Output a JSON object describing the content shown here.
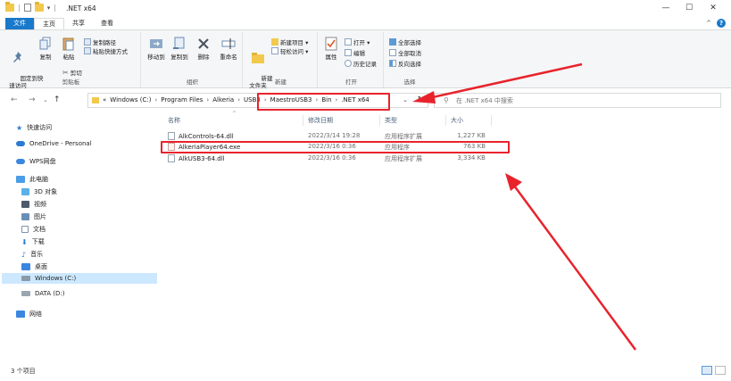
{
  "window": {
    "title": ".NET x64",
    "minimize": "—",
    "maximize": "☐",
    "close": "✕"
  },
  "tabs": [
    "文件",
    "主页",
    "共享",
    "查看"
  ],
  "ribbon": {
    "clipboard": {
      "pin_label": "固定到快\n速访问",
      "copy_label": "复制",
      "paste_label": "粘贴",
      "copy_path": "复制路径",
      "paste_shortcut": "粘贴快捷方式",
      "cut": "剪切",
      "group_label": "剪贴板"
    },
    "organize": {
      "move_to": "移动到",
      "copy_to": "复制到",
      "delete": "删除",
      "rename": "重命名",
      "group_label": "组织"
    },
    "new": {
      "new_folder": "新建\n文件夹",
      "new_item": "新建项目 ▾",
      "easy_access": "轻松访问 ▾",
      "group_label": "新建"
    },
    "open": {
      "properties": "属性",
      "open": "打开 ▾",
      "edit": "编辑",
      "history": "历史记录",
      "group_label": "打开"
    },
    "select": {
      "select_all": "全部选择",
      "select_none": "全部取消",
      "invert": "反向选择",
      "group_label": "选择"
    }
  },
  "address": {
    "crumbs": [
      "«",
      "Windows (C:)",
      "Program Files",
      "Alkeria",
      "USB3",
      "MaestroUSB3",
      "Bin",
      ".NET x64"
    ],
    "search_placeholder": "在 .NET x64 中搜索"
  },
  "nav": {
    "quick_access": "快速访问",
    "onedrive": "OneDrive - Personal",
    "wps": "WPS网盘",
    "this_pc": "此电脑",
    "objects3d": "3D 对象",
    "videos": "视频",
    "pictures": "图片",
    "documents": "文档",
    "downloads": "下载",
    "music": "音乐",
    "desktop": "桌面",
    "drive_c": "Windows (C:)",
    "drive_d": "DATA (D:)",
    "network": "网络"
  },
  "columns": {
    "name": "名称",
    "date": "修改日期",
    "type": "类型",
    "size": "大小"
  },
  "files": [
    {
      "name": "AlkControls-64.dll",
      "date": "2022/3/14 19:28",
      "type": "应用程序扩展",
      "size": "1,227 KB"
    },
    {
      "name": "AlkeriaPlayer64.exe",
      "date": "2022/3/16 0:36",
      "type": "应用程序",
      "size": "763 KB"
    },
    {
      "name": "AlkUSB3-64.dll",
      "date": "2022/3/16 0:36",
      "type": "应用程序扩展",
      "size": "3,334 KB"
    }
  ],
  "status": {
    "count": "3 个项目"
  },
  "colors": {
    "accent": "#1979ca",
    "annotation": "#e8232c"
  }
}
